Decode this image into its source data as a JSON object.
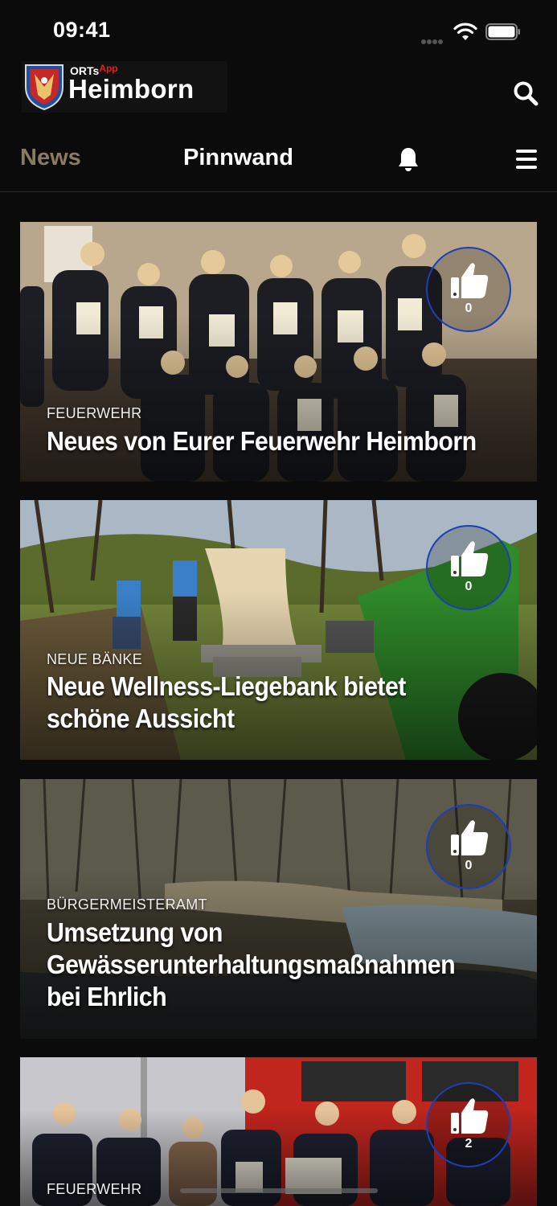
{
  "status_bar": {
    "time": "09:41"
  },
  "header": {
    "logo_small_prefix": "ORTs",
    "logo_small_suffix": "App",
    "logo_name": "Heimborn"
  },
  "tabs": [
    {
      "label": "News",
      "active": true
    },
    {
      "label": "Pinnwand",
      "active": false
    }
  ],
  "icons": {
    "search": "search-icon",
    "notifications": "bell-icon",
    "menu": "hamburger-menu-icon",
    "like": "thumbs-up-icon"
  },
  "colors": {
    "active_tab": "#8a7c62",
    "like_ring": "#1c3fb8",
    "background": "#0b0b0b"
  },
  "cards": [
    {
      "category": "FEUERWEHR",
      "title": "Neues von Eurer Feuerwehr Heimborn",
      "likes": "0"
    },
    {
      "category": "NEUE BÄNKE",
      "title": "Neue Wellness-Liegebank bietet schöne Aussicht",
      "likes": "0"
    },
    {
      "category": "BÜRGERMEISTERAMT",
      "title": "Umsetzung von Gewässerunterhaltungsmaßnahmen bei Ehrlich",
      "likes": "0"
    },
    {
      "category": "FEUERWEHR",
      "title": "",
      "likes": "2"
    }
  ]
}
